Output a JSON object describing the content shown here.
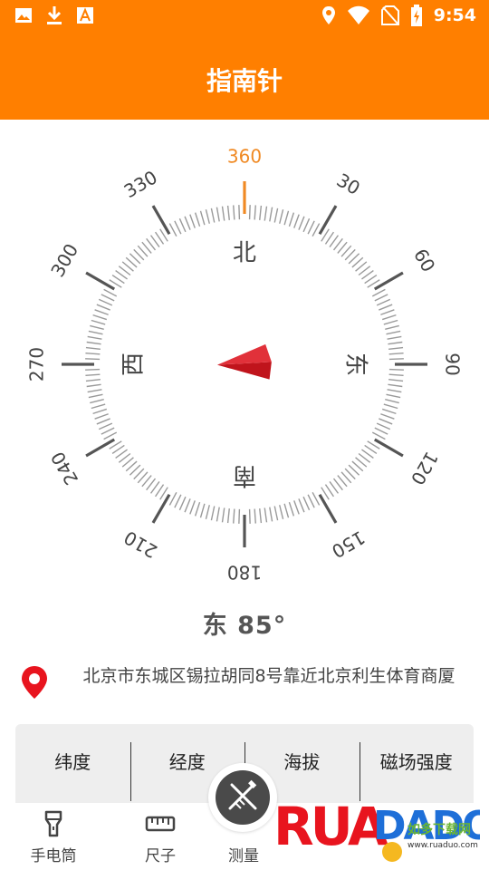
{
  "status_bar": {
    "time": "9:54",
    "left_icons": [
      "image-icon",
      "download-icon",
      "font-icon"
    ],
    "right_icons": [
      "location-icon",
      "wifi-icon",
      "no-sim-icon",
      "battery-charging-icon"
    ]
  },
  "title": "指南针",
  "compass": {
    "heading_degrees": 85,
    "degree_labels": [
      "360",
      "30",
      "60",
      "90",
      "120",
      "150",
      "180",
      "210",
      "240",
      "270",
      "300",
      "330"
    ],
    "cardinals": {
      "north": "北",
      "east": "东",
      "south": "南",
      "west": "西"
    },
    "accent_color": "#F08A24",
    "needle_color": "#C0141C"
  },
  "heading_text": "东 85°",
  "location": {
    "address": "北京市东城区锡拉胡同8号靠近北京利生体育商厦"
  },
  "info_panel": {
    "headers": [
      "纬度",
      "经度",
      "海拔",
      "磁场强度"
    ]
  },
  "bottom_nav": {
    "items": [
      {
        "label": "手电筒",
        "icon": "flashlight-icon"
      },
      {
        "label": "尺子",
        "icon": "ruler-icon"
      },
      {
        "label": "测量",
        "icon": "measure-icon"
      }
    ]
  },
  "watermark": {
    "brand": "RUADADO",
    "subtitle": "如多下载网",
    "url": "www.ruaduo.com"
  }
}
